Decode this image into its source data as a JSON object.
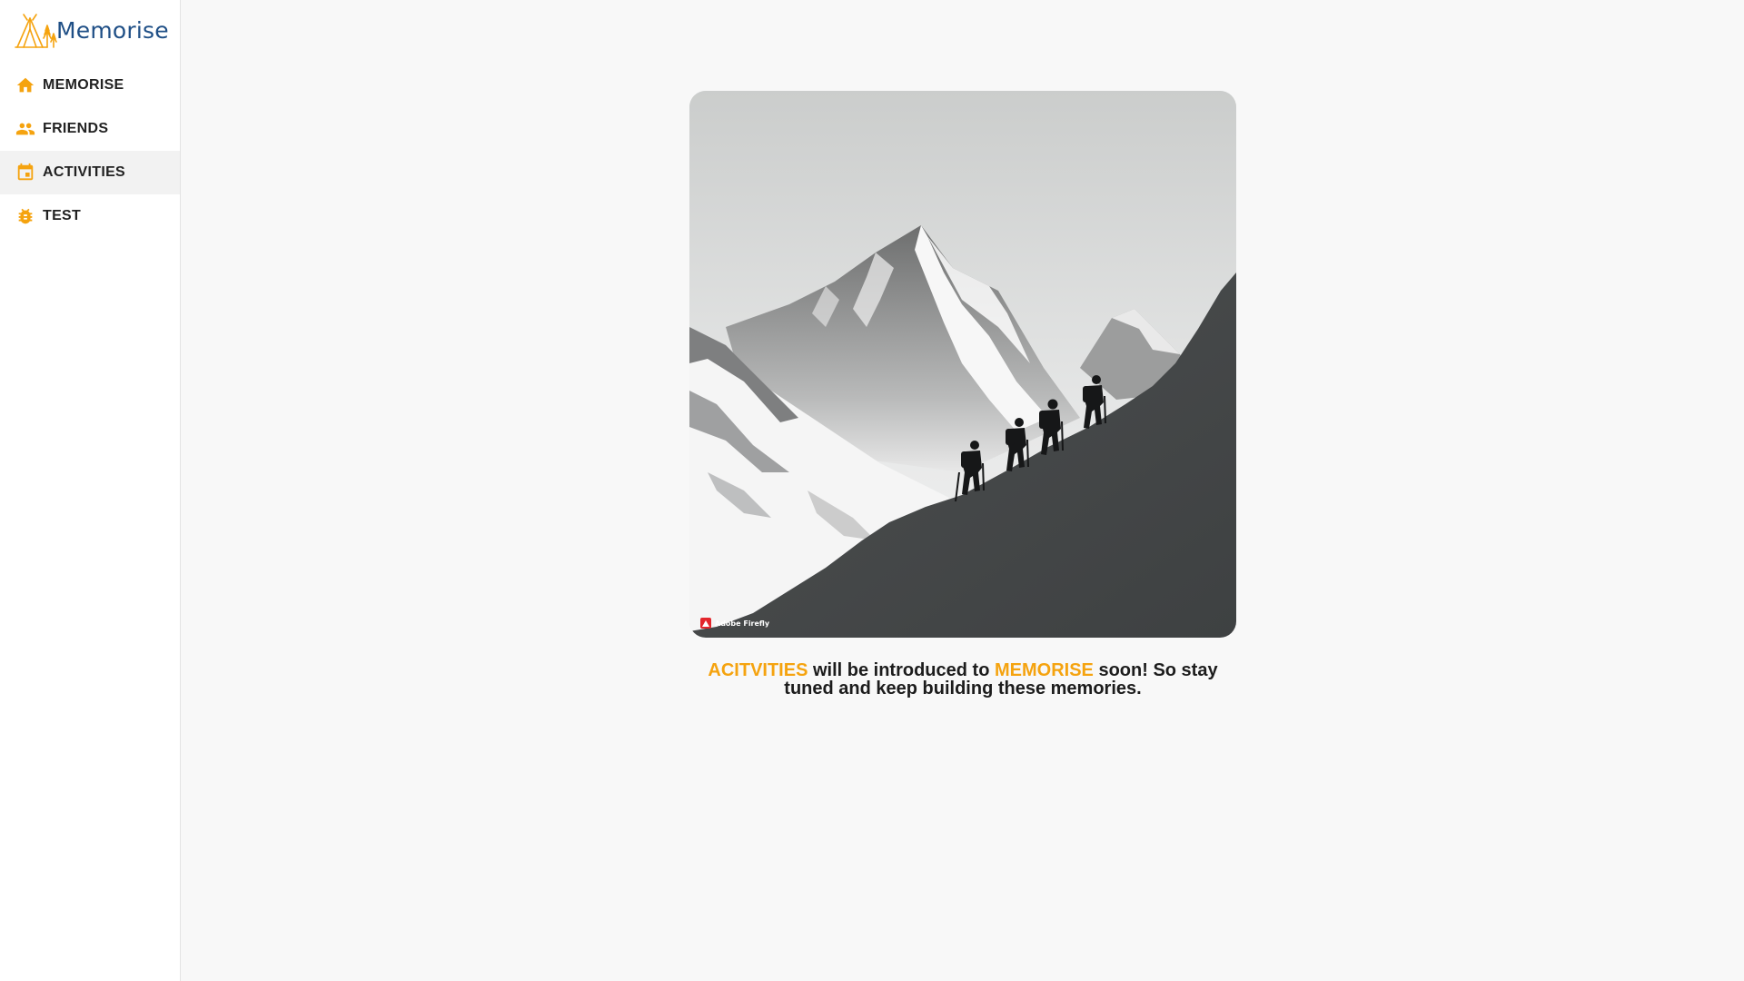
{
  "brand": {
    "name": "Memorise"
  },
  "sidebar": {
    "items": [
      {
        "label": "MEMORISE",
        "icon": "home-icon"
      },
      {
        "label": "FRIENDS",
        "icon": "people-icon"
      },
      {
        "label": "ACTIVITIES",
        "icon": "calendar-icon",
        "active": true
      },
      {
        "label": "TEST",
        "icon": "bug-icon"
      }
    ]
  },
  "main": {
    "hero": {
      "icon": "mountain-hikers-illustration",
      "watermark": "Adobe Firefly"
    },
    "message": {
      "part1": "ACITVITIES",
      "part2": " will be introduced to ",
      "part3": "MEMORISE",
      "part4": " soon! So stay tuned and keep building these memories."
    }
  },
  "colors": {
    "accent": "#f5a30f",
    "brand_text": "#1f4f86",
    "background": "#f8f8f8",
    "sidebar_active": "#f2f2f2",
    "text": "#1c1c1c"
  }
}
